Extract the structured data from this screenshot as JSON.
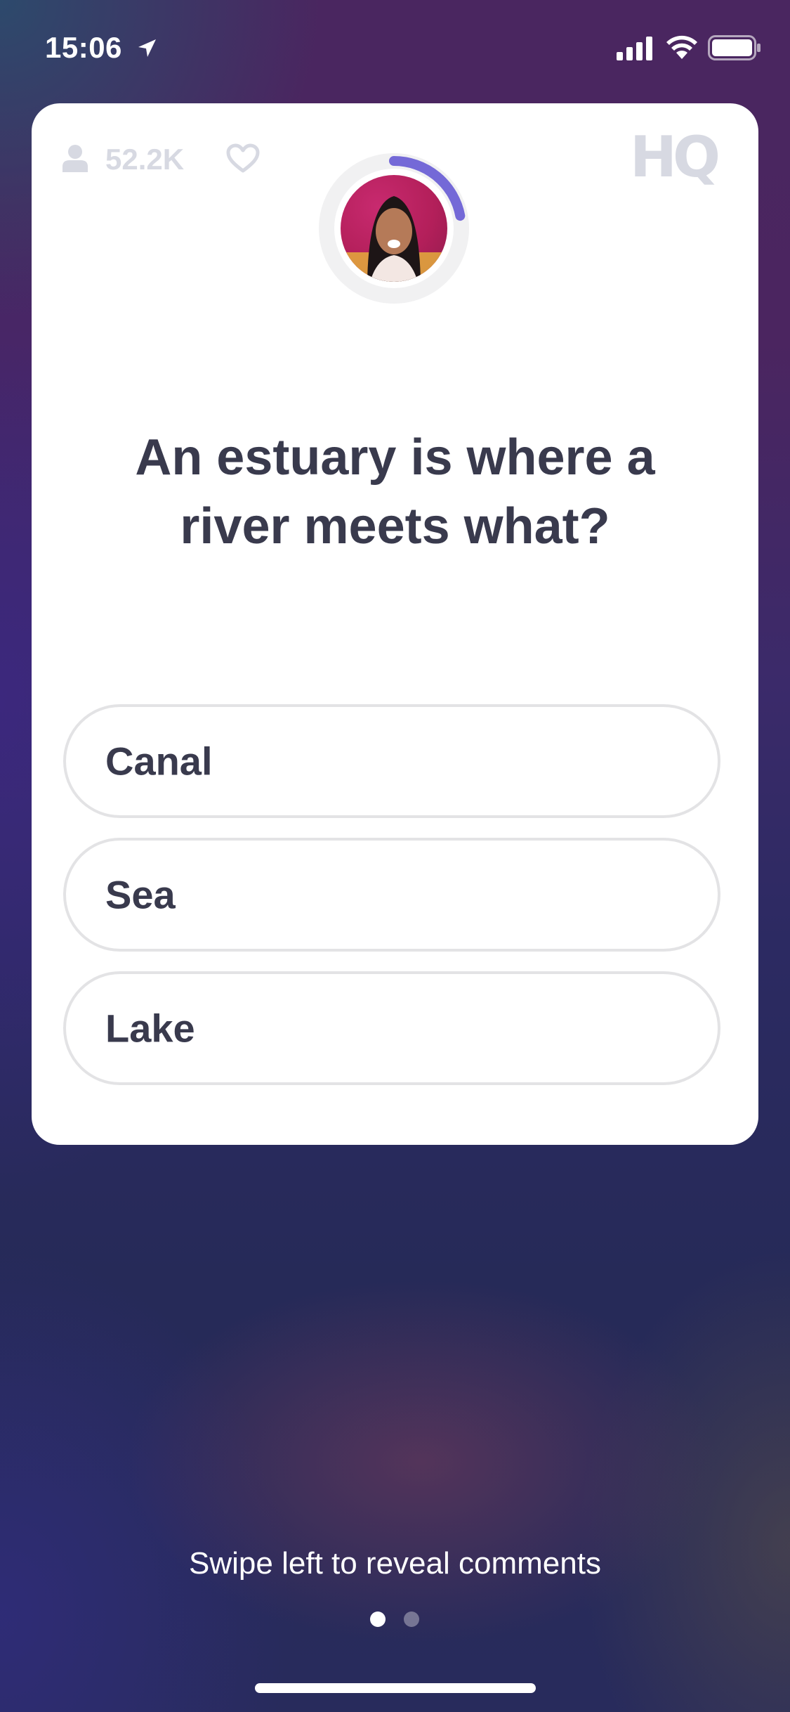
{
  "status_bar": {
    "time": "15:06"
  },
  "card": {
    "viewer_count": "52.2K",
    "logo_text": "HQ",
    "question": "An estuary is where a river meets what?",
    "timer_progress": 0.22,
    "answers": [
      {
        "label": "Canal"
      },
      {
        "label": "Sea"
      },
      {
        "label": "Lake"
      }
    ]
  },
  "footer": {
    "swipe_hint": "Swipe left to reveal comments",
    "page_count": 2,
    "active_page": 1
  },
  "colors": {
    "card_background": "#ffffff",
    "text_dark": "#393a4d",
    "answer_border": "#e3e3e5",
    "timer_accent": "#7469d7",
    "icon_muted": "#d7d9e2"
  },
  "icons": {
    "location": "location-arrow-icon",
    "signal": "cellular-signal-icon",
    "wifi": "wifi-icon",
    "battery": "battery-icon",
    "viewers": "person-icon",
    "heart": "heart-outline-icon"
  }
}
